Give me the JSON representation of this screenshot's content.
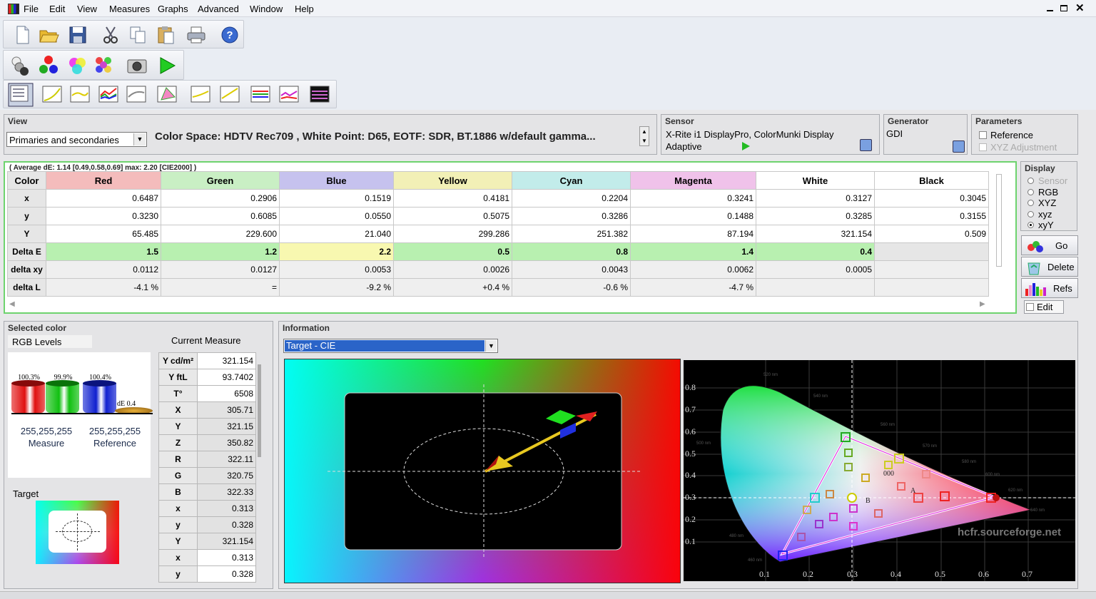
{
  "menu": [
    "File",
    "Edit",
    "View",
    "Measures",
    "Graphs",
    "Advanced",
    "Window",
    "Help"
  ],
  "view_panel": {
    "title": "View",
    "dropdown": "Primaries and secondaries",
    "info": "Color Space: HDTV Rec709 , White Point: D65, EOTF:  SDR, BT.1886 w/default gamma..."
  },
  "sensor_panel": {
    "title": "Sensor",
    "line1": "X-Rite i1 DisplayPro, ColorMunki Display",
    "line2": "Adaptive"
  },
  "generator_panel": {
    "title": "Generator",
    "value": "GDI"
  },
  "parameters_panel": {
    "title": "Parameters",
    "reference": "Reference",
    "xyz_adjustment": "XYZ Adjustment"
  },
  "measures": {
    "summary": "( Average dE: 1.14 [0.49,0.58,0.69] max: 2.20 [CIE2000] )",
    "columns": [
      "Color",
      "Red",
      "Green",
      "Blue",
      "Yellow",
      "Cyan",
      "Magenta",
      "White",
      "Black"
    ],
    "header_colors": [
      "#e6e6e6",
      "#f4bcbc",
      "#c9efc4",
      "#c6c2ee",
      "#f2f0b6",
      "#c2ecea",
      "#f0c2ea",
      "#ffffff",
      "#ffffff"
    ],
    "rows": [
      {
        "label": "x",
        "cells": [
          "0.6487",
          "0.2906",
          "0.1519",
          "0.4181",
          "0.2204",
          "0.3241",
          "0.3127",
          "0.3045"
        ]
      },
      {
        "label": "y",
        "cells": [
          "0.3230",
          "0.6085",
          "0.0550",
          "0.5075",
          "0.3286",
          "0.1488",
          "0.3285",
          "0.3155"
        ]
      },
      {
        "label": "Y",
        "cells": [
          "65.485",
          "229.600",
          "21.040",
          "299.286",
          "251.382",
          "87.194",
          "321.154",
          "0.509"
        ]
      },
      {
        "label": "Delta E",
        "cells": [
          "1.5",
          "1.2",
          "2.2",
          "0.5",
          "0.8",
          "1.4",
          "0.4",
          ""
        ]
      },
      {
        "label": "delta xy",
        "cells": [
          "0.0112",
          "0.0127",
          "0.0053",
          "0.0026",
          "0.0043",
          "0.0062",
          "0.0005",
          ""
        ]
      },
      {
        "label": "delta L",
        "cells": [
          "-4.1 %",
          "=",
          "-9.2 %",
          "+0.4 %",
          "-0.6 %",
          "-4.7 %",
          "",
          ""
        ]
      }
    ]
  },
  "display_panel": {
    "title": "Display",
    "options": [
      "Sensor",
      "RGB",
      "XYZ",
      "xyz",
      "xyY"
    ],
    "selected": "xyY",
    "go": "Go",
    "delete": "Delete",
    "refs": "Refs",
    "edit": "Edit"
  },
  "selected_color": {
    "title": "Selected color",
    "rgb_levels": "RGB Levels",
    "current_measure": "Current Measure",
    "bars": [
      {
        "label": "100.3%",
        "value": 100.3,
        "color": "#e01010"
      },
      {
        "label": "99.9%",
        "value": 99.9,
        "color": "#10c010"
      },
      {
        "label": "100.4%",
        "value": 100.4,
        "color": "#1020d0"
      }
    ],
    "de_label": "dE 0.4",
    "measure_rgb": "255,255,255",
    "measure_label": "Measure",
    "reference_rgb": "255,255,255",
    "reference_label": "Reference",
    "target_label": "Target",
    "table": [
      {
        "label": "Y cd/m²",
        "value": "321.154"
      },
      {
        "label": "Y ftL",
        "value": "93.7402"
      },
      {
        "label": "T°",
        "value": "6508"
      },
      {
        "label": "X",
        "value": "305.71"
      },
      {
        "label": "Y",
        "value": "321.15"
      },
      {
        "label": "Z",
        "value": "350.82"
      },
      {
        "label": "R",
        "value": "322.11"
      },
      {
        "label": "G",
        "value": "320.75"
      },
      {
        "label": "B",
        "value": "322.33"
      },
      {
        "label": "x",
        "value": "0.313"
      },
      {
        "label": "y",
        "value": "0.328"
      },
      {
        "label": "Y",
        "value": "321.154"
      },
      {
        "label": "x",
        "value": "0.313"
      },
      {
        "label": "y",
        "value": "0.328"
      }
    ]
  },
  "information": {
    "title": "Information",
    "dropdown": "Target - CIE",
    "cie_x_ticks": [
      "0.1",
      "0.2",
      "0.3",
      "0.4",
      "0.5",
      "0.6",
      "0.7"
    ],
    "cie_y_ticks": [
      "0.8",
      "0.7",
      "0.6",
      "0.5",
      "0.4",
      "0.3",
      "0.2",
      "0.1"
    ],
    "wavelengths": [
      "520 nm",
      "540 nm",
      "560 nm",
      "500 nm",
      "570 nm",
      "580 nm",
      "600 nm",
      "620 nm",
      "640 nm",
      "480 nm",
      "460 nm"
    ],
    "watermark": "hcfr.sourceforge.net"
  }
}
